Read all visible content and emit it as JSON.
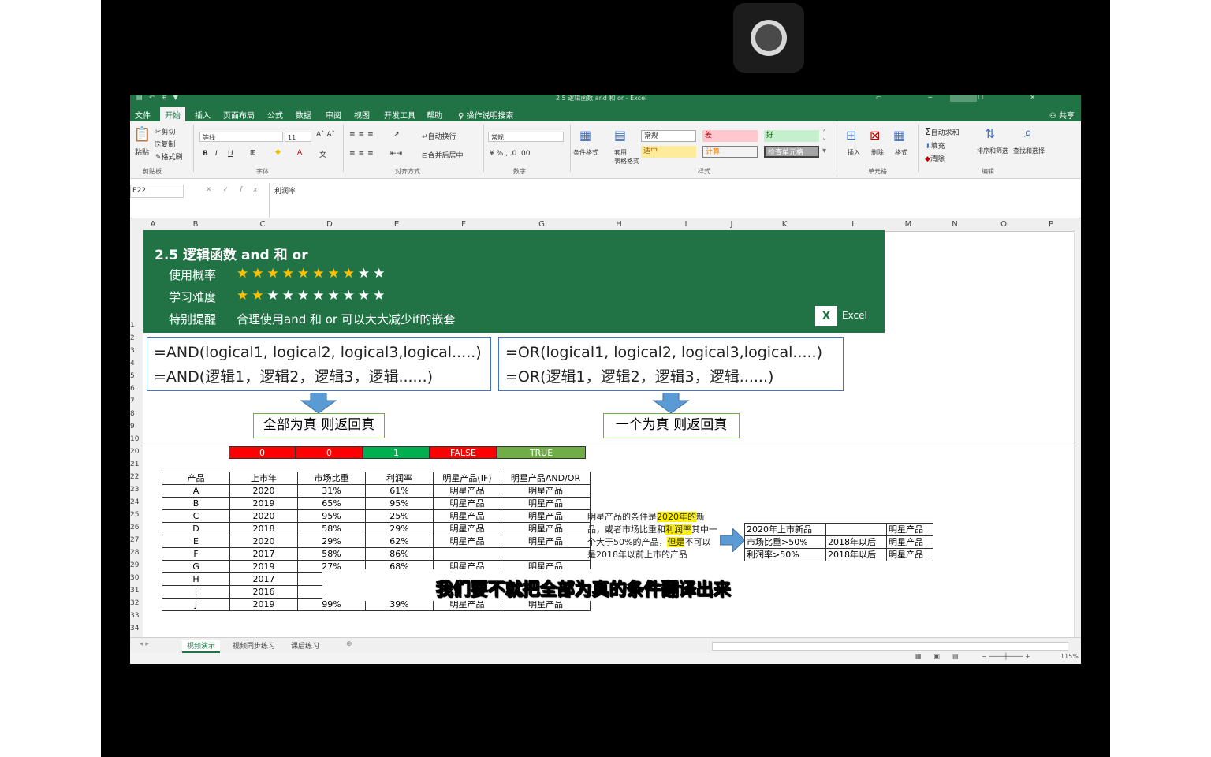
{
  "window": {
    "title": "2.5 逻辑函数 and 和 or - Excel"
  },
  "tabs": [
    {
      "label": "文件"
    },
    {
      "label": "开始"
    },
    {
      "label": "插入"
    },
    {
      "label": "页面布局"
    },
    {
      "label": "公式"
    },
    {
      "label": "数据"
    },
    {
      "label": "审阅"
    },
    {
      "label": "视图"
    },
    {
      "label": "开发工具"
    },
    {
      "label": "帮助"
    },
    {
      "label": "操作说明搜索"
    }
  ],
  "share_label": "共享",
  "ribbon": {
    "clipboard": {
      "paste": "粘贴",
      "cut": "剪切",
      "copy": "复制",
      "format_painter": "格式刷",
      "group": "剪贴板"
    },
    "font": {
      "name": "等线",
      "size": "11",
      "group": "字体"
    },
    "align": {
      "wrap": "自动换行",
      "merge": "合并后居中",
      "group": "对齐方式"
    },
    "number": {
      "format": "常规",
      "group": "数字"
    },
    "styles": {
      "conditional": "条件格式",
      "table": "套用\n表格格式",
      "normal": "常规",
      "bad": "差",
      "good": "好",
      "neutral": "适中",
      "calc": "计算",
      "check": "检查单元格",
      "group": "样式"
    },
    "cells": {
      "insert": "插入",
      "delete": "删除",
      "format": "格式",
      "group": "单元格"
    },
    "editing": {
      "autosum": "自动求和",
      "fill": "填充",
      "clear": "清除",
      "sort": "排序和筛选",
      "find": "查找和选择",
      "group": "编辑"
    }
  },
  "formula_bar": {
    "name_box": "E22",
    "value": "利润率"
  },
  "columns": [
    "A",
    "B",
    "C",
    "D",
    "E",
    "F",
    "G",
    "H",
    "I",
    "J",
    "K",
    "L",
    "M",
    "N",
    "O",
    "P"
  ],
  "rows": [
    "1",
    "2",
    "3",
    "4",
    "5",
    "6",
    "7",
    "8",
    "9",
    "10",
    "20",
    "21",
    "22",
    "23",
    "24",
    "25",
    "26",
    "27",
    "28",
    "29",
    "30",
    "31",
    "32",
    "33",
    "34"
  ],
  "banner": {
    "title": "2.5 逻辑函数 and 和 or",
    "usage_label": "使用概率",
    "usage_stars": "8 of 10",
    "difficulty_label": "学习难度",
    "difficulty_stars": "2 of 10",
    "tip_label": "特别提醒",
    "tip_value": "合理使用and 和 or 可以大大减少if的嵌套",
    "logo_text": "Excel"
  },
  "formulas": {
    "and_1": "=AND(logical1, logical2, logical3,logical.....)",
    "and_2": "=AND(逻辑1，逻辑2，逻辑3，逻辑......)",
    "or_1": "=OR(logical1, logical2, logical3,logical.....)",
    "or_2": "=OR(逻辑1，逻辑2，逻辑3，逻辑......)",
    "and_result": "全部为真 则返回真",
    "or_result": "一个为真 则返回真"
  },
  "result_row": [
    "0",
    "0",
    "1",
    "FALSE",
    "TRUE"
  ],
  "table": {
    "headers": [
      "产品",
      "上市年",
      "市场比重",
      "利润率",
      "明星产品(IF)",
      "明星产品AND/OR"
    ],
    "rows": [
      [
        "A",
        "2020",
        "31%",
        "61%",
        "明星产品",
        "明星产品"
      ],
      [
        "B",
        "2019",
        "65%",
        "95%",
        "明星产品",
        "明星产品"
      ],
      [
        "C",
        "2020",
        "95%",
        "25%",
        "明星产品",
        "明星产品"
      ],
      [
        "D",
        "2018",
        "58%",
        "29%",
        "明星产品",
        "明星产品"
      ],
      [
        "E",
        "2020",
        "29%",
        "62%",
        "明星产品",
        "明星产品"
      ],
      [
        "F",
        "2017",
        "58%",
        "86%",
        "",
        ""
      ],
      [
        "G",
        "2019",
        "27%",
        "68%",
        "明星产品",
        "明星产品"
      ],
      [
        "H",
        "2017",
        "",
        "",
        "",
        ""
      ],
      [
        "I",
        "2016",
        "",
        "",
        "",
        ""
      ],
      [
        "J",
        "2019",
        "99%",
        "39%",
        "明星产品",
        "明星产品"
      ]
    ]
  },
  "note": {
    "p1": "明星产品的条件是",
    "hl1": "2020年的",
    "p2": "新品，或者市场比重和",
    "hl2": "利润率",
    "p3": "其中一个大于50%的产品，",
    "hl3": "但是",
    "p4": "不可以是2018年以前上市的产品"
  },
  "cond_table": [
    [
      "2020年上市新品",
      "",
      "明星产品"
    ],
    [
      "市场比重>50%",
      "2018年以后",
      "明星产品"
    ],
    [
      "利润率>50%",
      "2018年以后",
      "明星产品"
    ]
  ],
  "sheets": [
    {
      "label": "视频演示"
    },
    {
      "label": "视频同步练习"
    },
    {
      "label": "课后练习"
    }
  ],
  "status": {
    "zoom": "115%"
  },
  "subtitle": "我们要不就把全部为真的条件翻译出来",
  "colors": {
    "excel_green": "#217346",
    "red": "#ff0000",
    "green": "#00b050",
    "olive": "#70ad47",
    "blue": "#4472c4"
  }
}
